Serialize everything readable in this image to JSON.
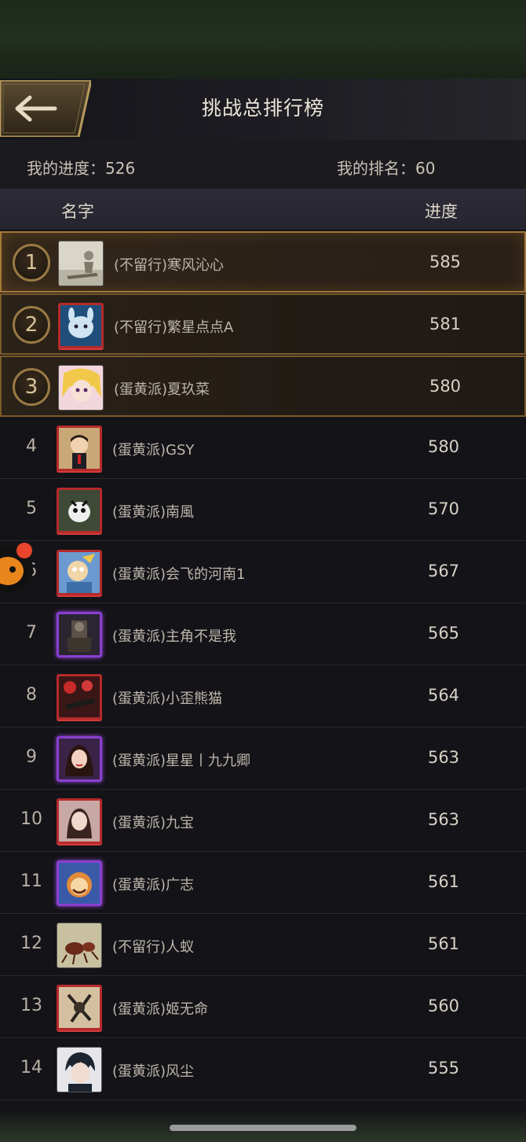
{
  "header": {
    "title": "挑战总排行榜"
  },
  "stats": {
    "my_progress_label": "我的进度：",
    "my_progress_value": "526",
    "my_rank_label": "我的排名：",
    "my_rank_value": "60"
  },
  "columns": {
    "name": "名字",
    "progress": "进度"
  },
  "rows": [
    {
      "rank": "1",
      "name": "(不留行)寒风沁心",
      "score": "585"
    },
    {
      "rank": "2",
      "name": "(不留行)繁星点点A",
      "score": "581"
    },
    {
      "rank": "3",
      "name": "(蛋黄派)夏玖菜",
      "score": "580"
    },
    {
      "rank": "4",
      "name": "(蛋黄派)GSY",
      "score": "580"
    },
    {
      "rank": "5",
      "name": "(蛋黄派)南風",
      "score": "570"
    },
    {
      "rank": "6",
      "name": "(蛋黄派)会飞的河南1",
      "score": "567"
    },
    {
      "rank": "7",
      "name": "(蛋黄派)主角不是我",
      "score": "565"
    },
    {
      "rank": "8",
      "name": "(蛋黄派)小歪熊猫",
      "score": "564"
    },
    {
      "rank": "9",
      "name": "(蛋黄派)星星丨九九卿",
      "score": "563"
    },
    {
      "rank": "10",
      "name": "(蛋黄派)九宝",
      "score": "563"
    },
    {
      "rank": "11",
      "name": "(蛋黄派)广志",
      "score": "561"
    },
    {
      "rank": "12",
      "name": "(不留行)人蚁",
      "score": "561"
    },
    {
      "rank": "13",
      "name": "(蛋黄派)姬无命",
      "score": "560"
    },
    {
      "rank": "14",
      "name": "(蛋黄派)风尘",
      "score": "555"
    }
  ],
  "colors": {
    "gold_border": "#a5783a",
    "frame_red": "#b52a2a",
    "frame_purple": "#8a3fd1",
    "badge_red": "#e8452c"
  },
  "icons": {
    "back": "arrow-left-icon",
    "floating": "floating-assistant-icon"
  }
}
